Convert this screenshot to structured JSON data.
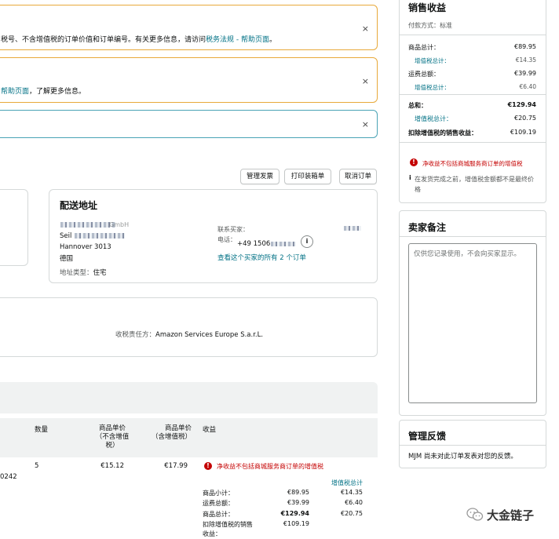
{
  "banners": [
    {
      "text_plain": "税号、不含增值税的订单价值和订单编号。有关更多信息，请访问",
      "text_link": "税务法规 - 帮助页面",
      "text_tail": "。",
      "close": "×"
    },
    {
      "text_link": "帮助页面",
      "text_tail": "，了解更多信息。",
      "close": "×"
    },
    {
      "close": "×"
    }
  ],
  "actions": {
    "manage_invoice": "管理发票",
    "print_packing_slip": "打印装箱单",
    "cancel_order": "取消订单"
  },
  "shipping": {
    "title": "配送地址",
    "name_line": "GmbH",
    "street_line": "Seil",
    "city_line": "Hannover 3013",
    "country": "德国",
    "address_type_label": "地址类型：",
    "address_type": "住宅",
    "contact_buyer_label": "联系买家：",
    "phone_label": "电话：",
    "phone_value": "+49 1506",
    "info_icon": "i",
    "view_all_orders": "查看这个买家的所有 2 个订单"
  },
  "tax_liability": {
    "label": "收税责任方：",
    "value": "Amazon Services Europe S.a.r.L."
  },
  "items_table": {
    "headers": {
      "qty": "数量",
      "unit_price_ex": "商品单价\n（不含增值\n税）",
      "unit_price_inc": "商品单价\n（含增值税）",
      "proceeds": "收益"
    },
    "row": {
      "asin_fragment": "0242",
      "qty": "5",
      "unit_price_ex": "€15.12",
      "unit_price_inc": "€17.99",
      "warning": "净收益不包括商城服务商订单的增值税",
      "vat_total_header": "增值税总计",
      "lines": [
        {
          "label": "商品小计：",
          "value": "€89.95",
          "vat": "€14.35"
        },
        {
          "label": "运费总额：",
          "value": "€39.99",
          "vat": "€6.40"
        },
        {
          "label": "商品总计：",
          "value": "€129.94",
          "vat": "€20.75"
        },
        {
          "label": "扣除增值税的销售收益：",
          "value": "€109.19",
          "vat": ""
        }
      ]
    }
  },
  "sales_proceeds": {
    "title": "销售收益",
    "payment_method_label": "付款方式：",
    "payment_method": "标准",
    "rows": [
      {
        "label": "商品总计：",
        "value": "€89.95"
      },
      {
        "label": "增值税总计：",
        "value": "€14.35"
      },
      {
        "label": "运费总额：",
        "value": "€39.99"
      },
      {
        "label": "增值税总计：",
        "value": "€6.40"
      },
      {
        "label": "总和：",
        "value": "€129.94"
      },
      {
        "label": "增值税总计：",
        "value": "€20.75"
      },
      {
        "label": "扣除增值税的销售收益：",
        "value": "€109.19"
      }
    ],
    "warning": "净收益不包括商城服务商订单的增值税",
    "note_marker": "i",
    "note": "在发货完成之前，增值税金额都不是最终价格"
  },
  "seller_notes": {
    "title": "卖家备注",
    "placeholder": "仅供您记录使用，不会向买家显示。"
  },
  "feedback": {
    "title": "管理反馈",
    "text": "MJM 尚未对此订单发表对您的反馈。"
  },
  "watermark": {
    "text": "大金链子",
    "icon": "wechat-icon"
  },
  "colors": {
    "banner_warning": "#e8a93a",
    "banner_info": "#4aa3b5",
    "link": "#007185",
    "error": "#c40000"
  }
}
